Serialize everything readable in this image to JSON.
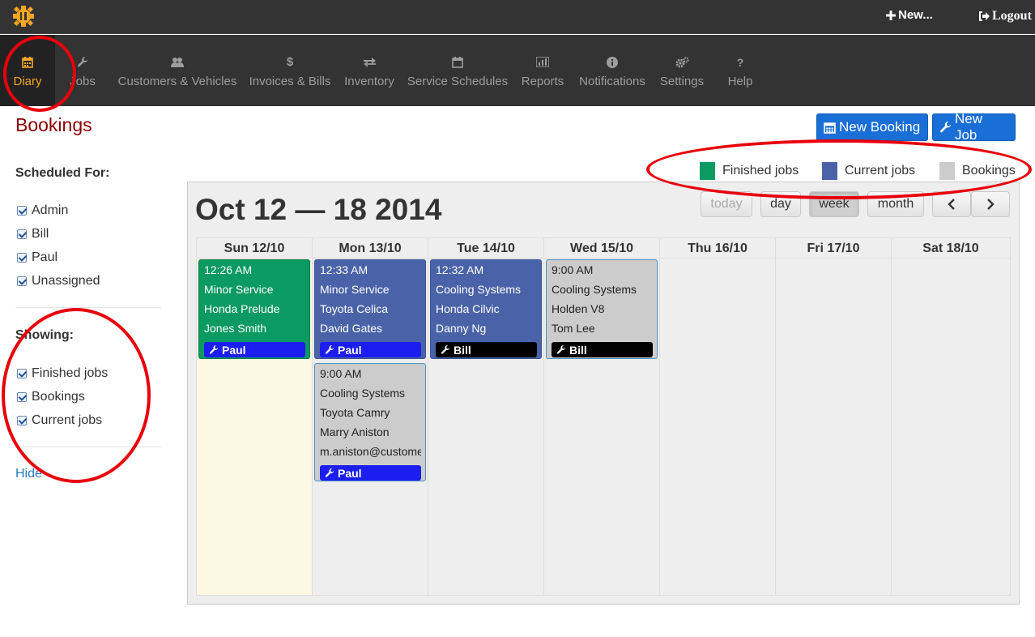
{
  "topbar": {
    "new_label": "New...",
    "logout_label": "Logout"
  },
  "nav": {
    "items": [
      {
        "label": "Diary",
        "icon": "calendar-icon"
      },
      {
        "label": "Jobs",
        "icon": "wrench-icon"
      },
      {
        "label": "Customers & Vehicles",
        "icon": "users-icon"
      },
      {
        "label": "Invoices & Bills",
        "icon": "dollar-icon"
      },
      {
        "label": "Inventory",
        "icon": "exchange-icon"
      },
      {
        "label": "Service Schedules",
        "icon": "calendar-icon"
      },
      {
        "label": "Reports",
        "icon": "bar-chart-icon"
      },
      {
        "label": "Notifications",
        "icon": "info-icon"
      },
      {
        "label": "Settings",
        "icon": "cogs-icon"
      },
      {
        "label": "Help",
        "icon": "question-icon"
      }
    ]
  },
  "page": {
    "title": "Bookings",
    "new_booking_label": "New Booking",
    "new_job_label": "New Job"
  },
  "legend": {
    "items": [
      {
        "label": "Finished jobs",
        "color": "#0a9a62"
      },
      {
        "label": "Current jobs",
        "color": "#4a63a8"
      },
      {
        "label": "Bookings",
        "color": "#cccccc"
      }
    ]
  },
  "sidebar": {
    "scheduled_heading": "Scheduled For:",
    "scheduled": [
      "Admin",
      "Bill",
      "Paul",
      "Unassigned"
    ],
    "showing_heading": "Showing:",
    "showing": [
      "Finished jobs",
      "Bookings",
      "Current jobs"
    ],
    "hide_label": "Hide"
  },
  "calendar": {
    "title": "Oct 12 — 18 2014",
    "buttons": {
      "today": "today",
      "day": "day",
      "week": "week",
      "month": "month"
    },
    "days": [
      "Sun 12/10",
      "Mon 13/10",
      "Tue 14/10",
      "Wed 15/10",
      "Thu 16/10",
      "Fri 17/10",
      "Sat 18/10"
    ],
    "events": [
      {
        "type": "finished",
        "time": "12:26 AM",
        "service": "Minor Service",
        "vehicle": "Honda Prelude",
        "customer": "Jones Smith",
        "assignee": "Paul"
      },
      {
        "type": "current",
        "time": "12:33 AM",
        "service": "Minor Service",
        "vehicle": "Toyota Celica",
        "customer": "David Gates",
        "assignee": "Paul"
      },
      {
        "type": "booking",
        "time": "9:00 AM",
        "service": "Cooling Systems",
        "vehicle": "Toyota Camry",
        "customer": "Marry Aniston",
        "email": "m.aniston@customer",
        "assignee": "Paul"
      },
      {
        "type": "current",
        "time": "12:32 AM",
        "service": "Cooling Systems",
        "vehicle": "Honda Cilvic",
        "customer": "Danny Ng",
        "assignee": "Bill"
      },
      {
        "type": "booking",
        "time": "9:00 AM",
        "service": "Cooling Systems",
        "vehicle": "Holden V8",
        "customer": "Tom Lee",
        "assignee": "Bill"
      }
    ]
  }
}
